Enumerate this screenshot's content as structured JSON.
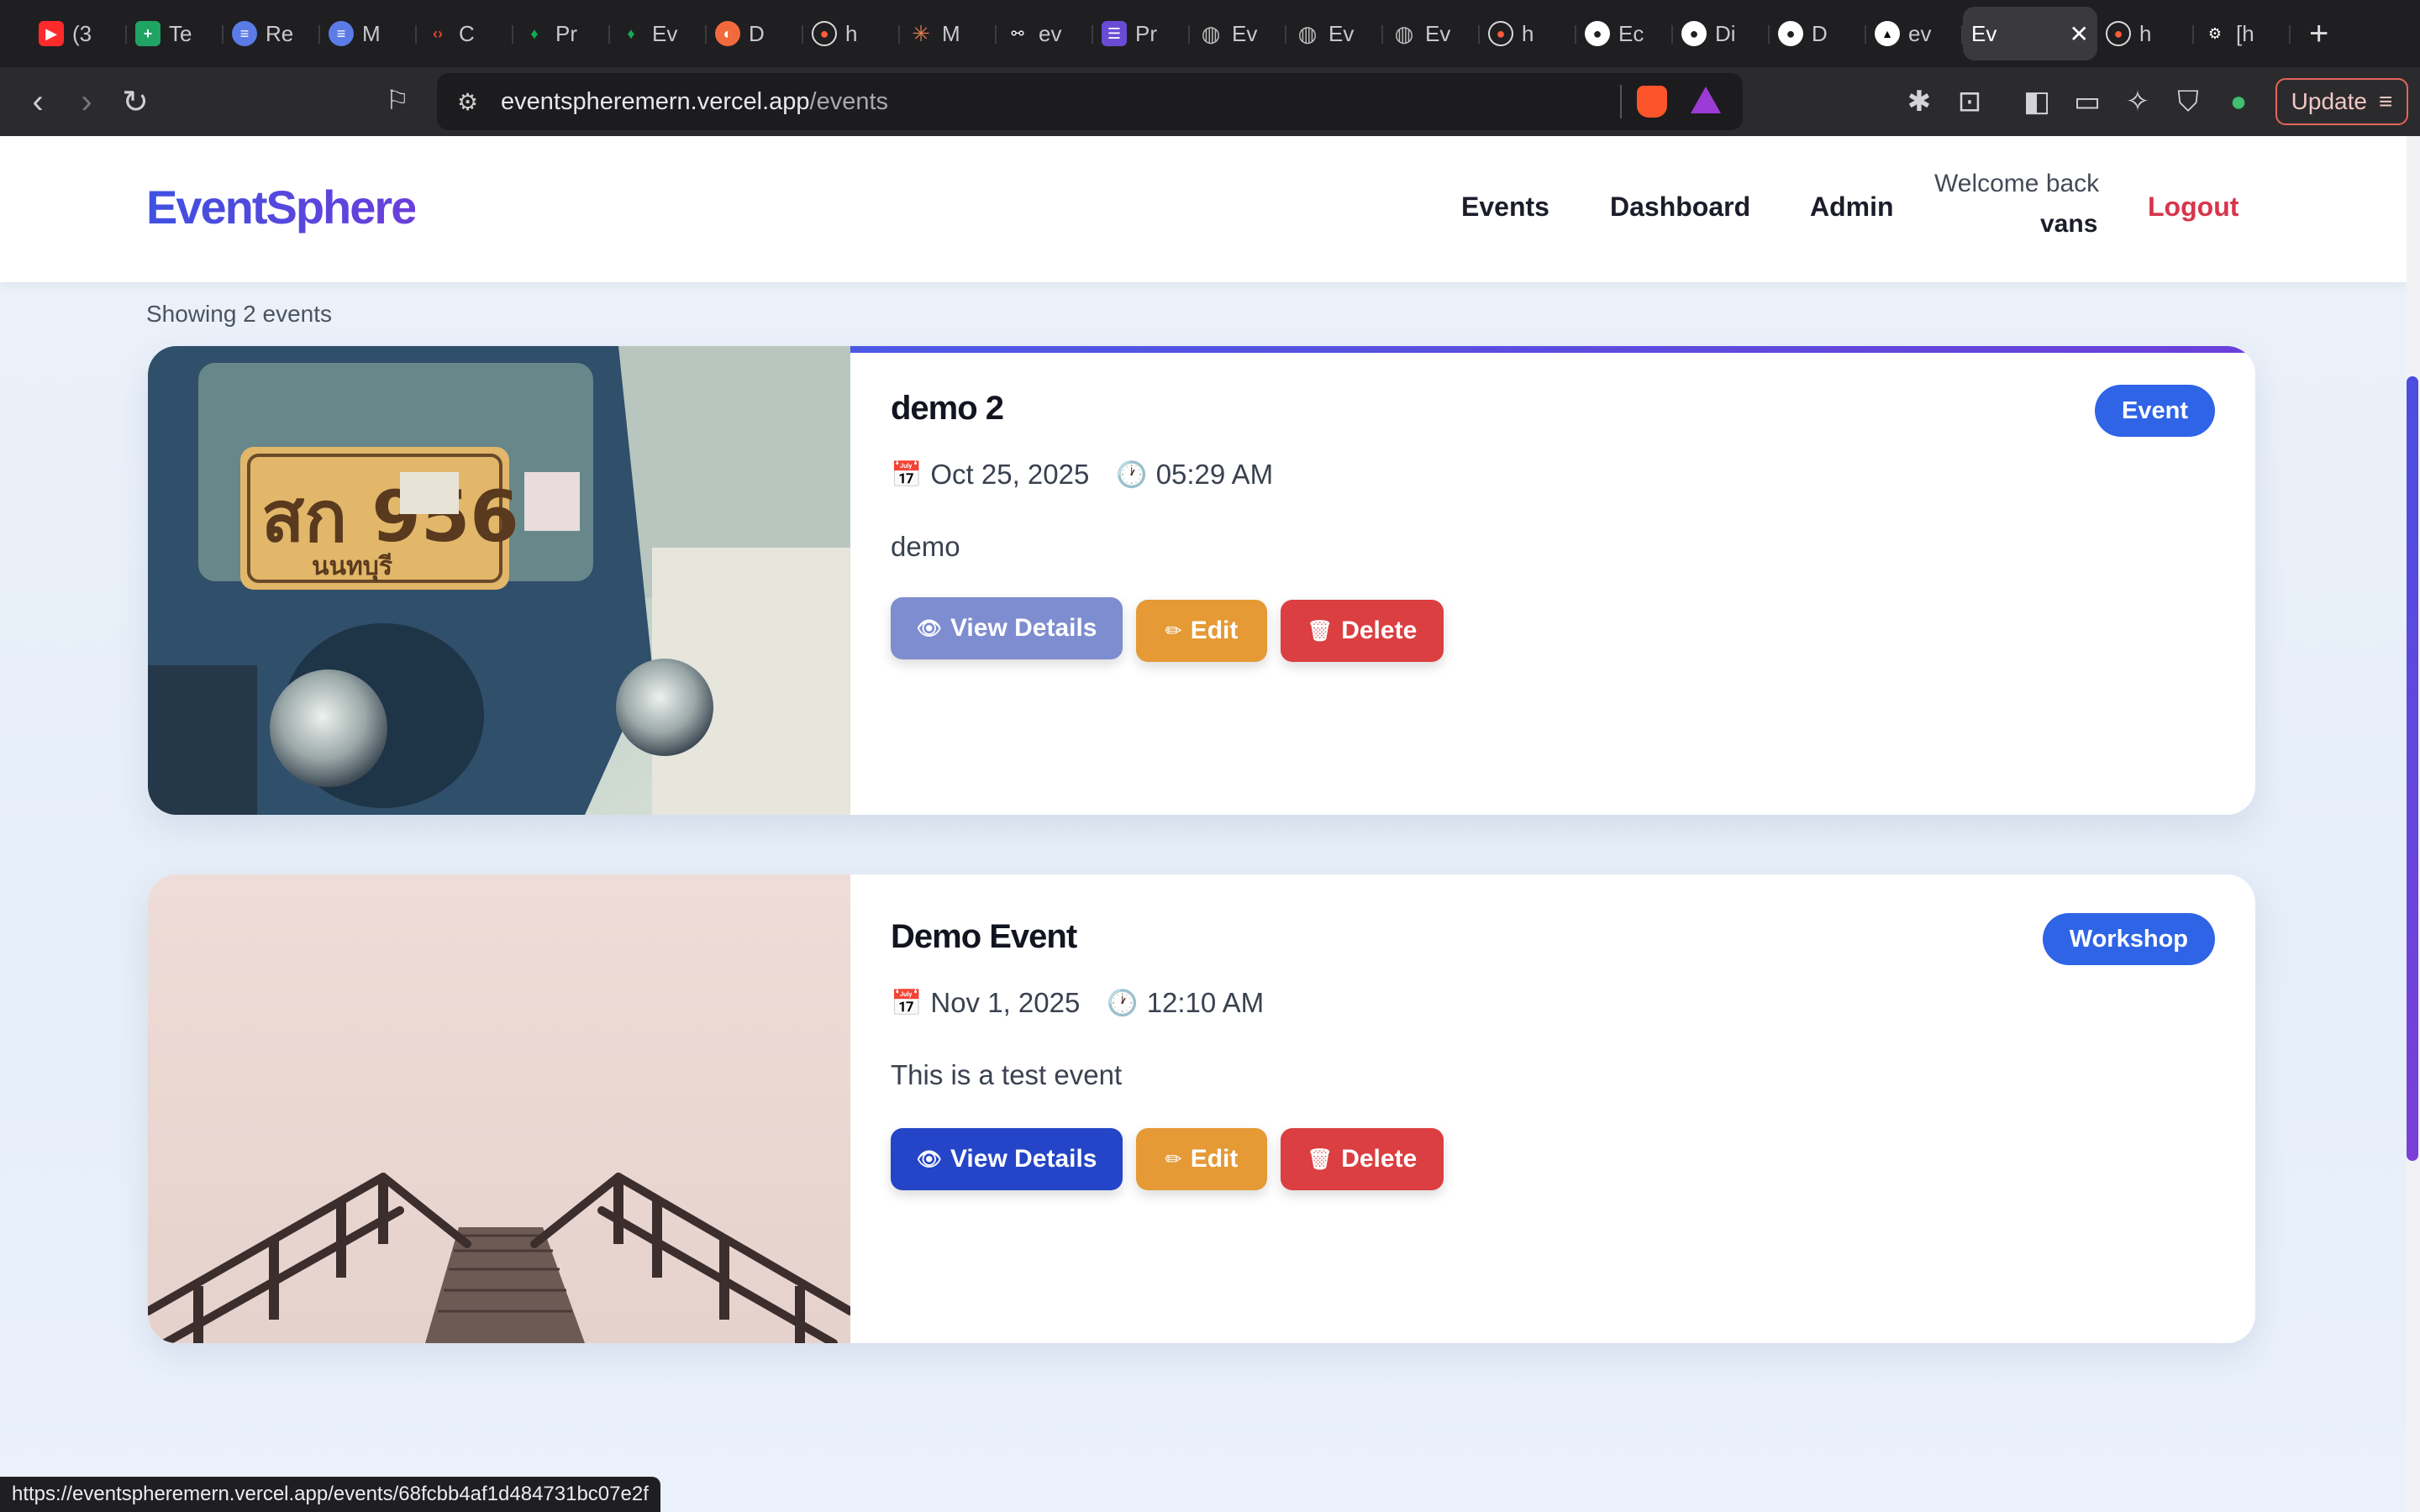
{
  "browser": {
    "tabs": [
      {
        "label": "(3",
        "icon": "youtube-icon",
        "color": "#ff2b2b"
      },
      {
        "label": "Te",
        "icon": "sheets-icon",
        "color": "#1fa463"
      },
      {
        "label": "Re",
        "icon": "doc-icon",
        "color": "#5b7ce6"
      },
      {
        "label": "M",
        "icon": "doc-icon",
        "color": "#5b7ce6"
      },
      {
        "label": "C",
        "icon": "code-icon",
        "color": "#e0442e"
      },
      {
        "label": "Pr",
        "icon": "mongodb-icon",
        "color": "#13aa52"
      },
      {
        "label": "Ev",
        "icon": "mongodb-icon",
        "color": "#13aa52"
      },
      {
        "label": "D",
        "icon": "render-icon",
        "color": "#f26a3c"
      },
      {
        "label": "h",
        "icon": "brave-icon",
        "color": "#d9d9d9"
      },
      {
        "label": "M",
        "icon": "claude-icon",
        "color": "#e07a4d"
      },
      {
        "label": "ev",
        "icon": "link-icon",
        "color": "#ffffff"
      },
      {
        "label": "Pr",
        "icon": "list-icon",
        "color": "#6a4bd6"
      },
      {
        "label": "Ev",
        "icon": "globe-icon",
        "color": "#bdbdbd"
      },
      {
        "label": "Ev",
        "icon": "globe-icon",
        "color": "#bdbdbd"
      },
      {
        "label": "Ev",
        "icon": "globe-icon",
        "color": "#bdbdbd"
      },
      {
        "label": "h",
        "icon": "brave-icon",
        "color": "#d9d9d9"
      },
      {
        "label": "Ec",
        "icon": "github-icon",
        "color": "#ffffff"
      },
      {
        "label": "Di",
        "icon": "github-icon",
        "color": "#ffffff"
      },
      {
        "label": "D",
        "icon": "github-icon",
        "color": "#ffffff"
      },
      {
        "label": "ev",
        "icon": "vercel-icon",
        "color": "#ffffff"
      },
      {
        "label": "Ev",
        "icon": "none",
        "color": "#ffffff",
        "active": true
      },
      {
        "label": "h",
        "icon": "brave-icon",
        "color": "#d9d9d9"
      },
      {
        "label": "[h",
        "icon": "grid-icon",
        "color": "#ffffff"
      }
    ],
    "address": {
      "host": "eventspheremern.vercel.app",
      "path": "/events"
    },
    "update_label": "Update",
    "status_url": "https://eventspheremern.vercel.app/events/68fcbb4af1d484731bc07e2f"
  },
  "site": {
    "logo": "EventSphere",
    "nav": {
      "events": "Events",
      "dashboard": "Dashboard",
      "admin": "Admin"
    },
    "welcome": "Welcome back",
    "username": "vans",
    "logout": "Logout"
  },
  "events": {
    "count_text": "Showing 2 events",
    "items": [
      {
        "title": "demo 2",
        "badge": "Event",
        "date": "Oct 25, 2025",
        "time": "05:29 AM",
        "description": "demo",
        "view_label": "View Details",
        "edit_label": "Edit",
        "delete_label": "Delete"
      },
      {
        "title": "Demo Event",
        "badge": "Workshop",
        "date": "Nov 1, 2025",
        "time": "12:10 AM",
        "description": "This is a test event",
        "view_label": "View Details",
        "edit_label": "Edit",
        "delete_label": "Delete"
      }
    ]
  },
  "colors": {
    "accent": "#2f64e6",
    "brand_gradient_start": "#3f51e0",
    "brand_gradient_end": "#6a3fdb",
    "danger": "#d8354a",
    "edit": "#e59a35"
  }
}
